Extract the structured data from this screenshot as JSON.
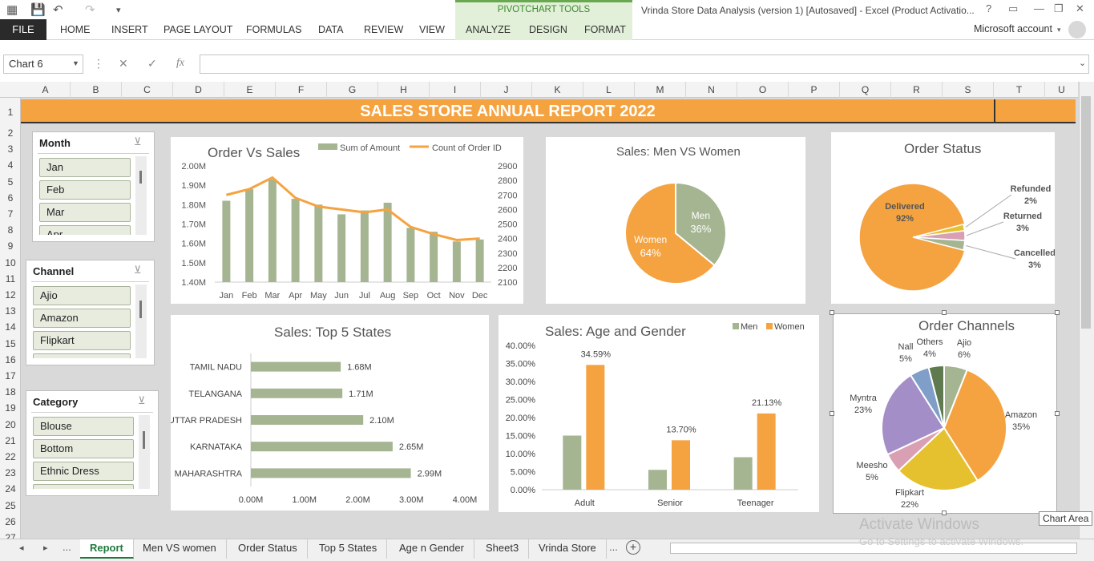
{
  "window": {
    "title": "Vrinda Store Data Analysis (version 1) [Autosaved] - Excel (Product Activatio...",
    "account": "Microsoft account",
    "help": "?"
  },
  "ribbon": {
    "file": "FILE",
    "tabs": [
      "HOME",
      "INSERT",
      "PAGE LAYOUT",
      "FORMULAS",
      "DATA",
      "REVIEW",
      "VIEW"
    ],
    "pivot_label": "PIVOTCHART TOOLS",
    "pivot_tabs": [
      "ANALYZE",
      "DESIGN",
      "FORMAT"
    ]
  },
  "formula": {
    "namebox": "Chart 6",
    "fx": "fx",
    "value": ""
  },
  "columns": [
    "A",
    "B",
    "C",
    "D",
    "E",
    "F",
    "G",
    "H",
    "I",
    "J",
    "K",
    "L",
    "M",
    "N",
    "O",
    "P",
    "Q",
    "R",
    "S",
    "T",
    "U"
  ],
  "rows": [
    "1",
    "2",
    "3",
    "4",
    "5",
    "6",
    "7",
    "8",
    "9",
    "10",
    "11",
    "12",
    "13",
    "14",
    "15",
    "16",
    "17",
    "18",
    "19",
    "20",
    "21",
    "22",
    "23",
    "24",
    "25",
    "26",
    "27"
  ],
  "banner": "SALES STORE ANNUAL REPORT 2022",
  "slicers": {
    "month": {
      "title": "Month",
      "items": [
        "Jan",
        "Feb",
        "Mar",
        "Apr"
      ]
    },
    "channel": {
      "title": "Channel",
      "items": [
        "Ajio",
        "Amazon",
        "Flipkart"
      ]
    },
    "category": {
      "title": "Category",
      "items": [
        "Blouse",
        "Bottom",
        "Ethnic Dress"
      ]
    }
  },
  "chart_data": [
    {
      "type": "bar",
      "title": "Order Vs Sales",
      "categories": [
        "Jan",
        "Feb",
        "Mar",
        "Apr",
        "May",
        "Jun",
        "Jul",
        "Aug",
        "Sep",
        "Oct",
        "Nov",
        "Dec"
      ],
      "series": [
        {
          "name": "Sum of Amount",
          "values": [
            1.82,
            1.88,
            1.93,
            1.83,
            1.8,
            1.75,
            1.77,
            1.81,
            1.68,
            1.66,
            1.61,
            1.62
          ],
          "color": "#a5b592"
        },
        {
          "name": "Count of Order ID",
          "type": "line",
          "axis": "secondary",
          "values": [
            2700,
            2740,
            2820,
            2680,
            2620,
            2600,
            2580,
            2600,
            2480,
            2430,
            2390,
            2400
          ],
          "color": "#f4a340"
        }
      ],
      "y_ticks": [
        "2.00M",
        "1.90M",
        "1.80M",
        "1.70M",
        "1.60M",
        "1.50M",
        "1.40M"
      ],
      "y2_ticks": [
        "2900",
        "2800",
        "2700",
        "2600",
        "2500",
        "2400",
        "2300",
        "2200",
        "2100"
      ],
      "ylim": [
        1.4,
        2.0
      ],
      "y2lim": [
        2100,
        2900
      ]
    },
    {
      "type": "pie",
      "title": "Sales: Men VS Women",
      "labels": [
        "Men",
        "Women"
      ],
      "values": [
        36,
        64
      ],
      "pct_labels": [
        "36%",
        "64%"
      ],
      "colors": [
        "#a5b592",
        "#f4a340"
      ]
    },
    {
      "type": "pie",
      "title": "Order Status",
      "labels": [
        "Delivered",
        "Refunded",
        "Returned",
        "Cancelled"
      ],
      "values": [
        92,
        2,
        3,
        3
      ],
      "pct_labels": [
        "92%",
        "2%",
        "3%",
        "3%"
      ],
      "colors": [
        "#f4a340",
        "#e6c12f",
        "#d9a0b4",
        "#a5b592"
      ]
    },
    {
      "type": "bar",
      "orientation": "horizontal",
      "title": "Sales: Top 5 States",
      "categories": [
        "TAMIL NADU",
        "TELANGANA",
        "UTTAR PRADESH",
        "KARNATAKA",
        "MAHARASHTRA"
      ],
      "values": [
        1.68,
        1.71,
        2.1,
        2.65,
        2.99
      ],
      "value_labels": [
        "1.68M",
        "1.71M",
        "2.10M",
        "2.65M",
        "2.99M"
      ],
      "x_ticks": [
        "0.00M",
        "1.00M",
        "2.00M",
        "3.00M",
        "4.00M"
      ],
      "xlim": [
        0,
        4
      ]
    },
    {
      "type": "bar",
      "title": "Sales: Age and Gender",
      "categories": [
        "Adult",
        "Senior",
        "Teenager"
      ],
      "series": [
        {
          "name": "Men",
          "values": [
            15.0,
            5.5,
            9.0
          ],
          "color": "#a5b592"
        },
        {
          "name": "Women",
          "values": [
            34.59,
            13.7,
            21.13
          ],
          "labels": [
            "34.59%",
            "13.70%",
            "21.13%"
          ],
          "color": "#f4a340"
        }
      ],
      "y_ticks": [
        "40.00%",
        "35.00%",
        "30.00%",
        "25.00%",
        "20.00%",
        "15.00%",
        "10.00%",
        "5.00%",
        "0.00%"
      ],
      "ylim": [
        0,
        40
      ]
    },
    {
      "type": "pie",
      "title": "Order Channels",
      "labels": [
        "Ajio",
        "Amazon",
        "Flipkart",
        "Meesho",
        "Myntra",
        "Nall",
        "Others"
      ],
      "values": [
        6,
        35,
        22,
        5,
        23,
        5,
        4
      ],
      "pct_labels": [
        "6%",
        "35%",
        "22%",
        "5%",
        "23%",
        "5%",
        "4%"
      ],
      "colors": [
        "#a5b592",
        "#f4a340",
        "#e6c12f",
        "#d9a0b4",
        "#a38ec8",
        "#7f9fc8",
        "#5f7a4e"
      ]
    }
  ],
  "tabs": [
    "Report",
    "Men VS women",
    "Order Status",
    "Top 5 States",
    "Age n Gender",
    "Sheet3",
    "Vrinda Store",
    "..."
  ],
  "nav": {
    "ellipsis": "...",
    "add": "+"
  },
  "overlay": {
    "activate": "Activate Windows",
    "activate_sub": "Go to Settings to activate Windows.",
    "tooltip": "Chart Area"
  }
}
